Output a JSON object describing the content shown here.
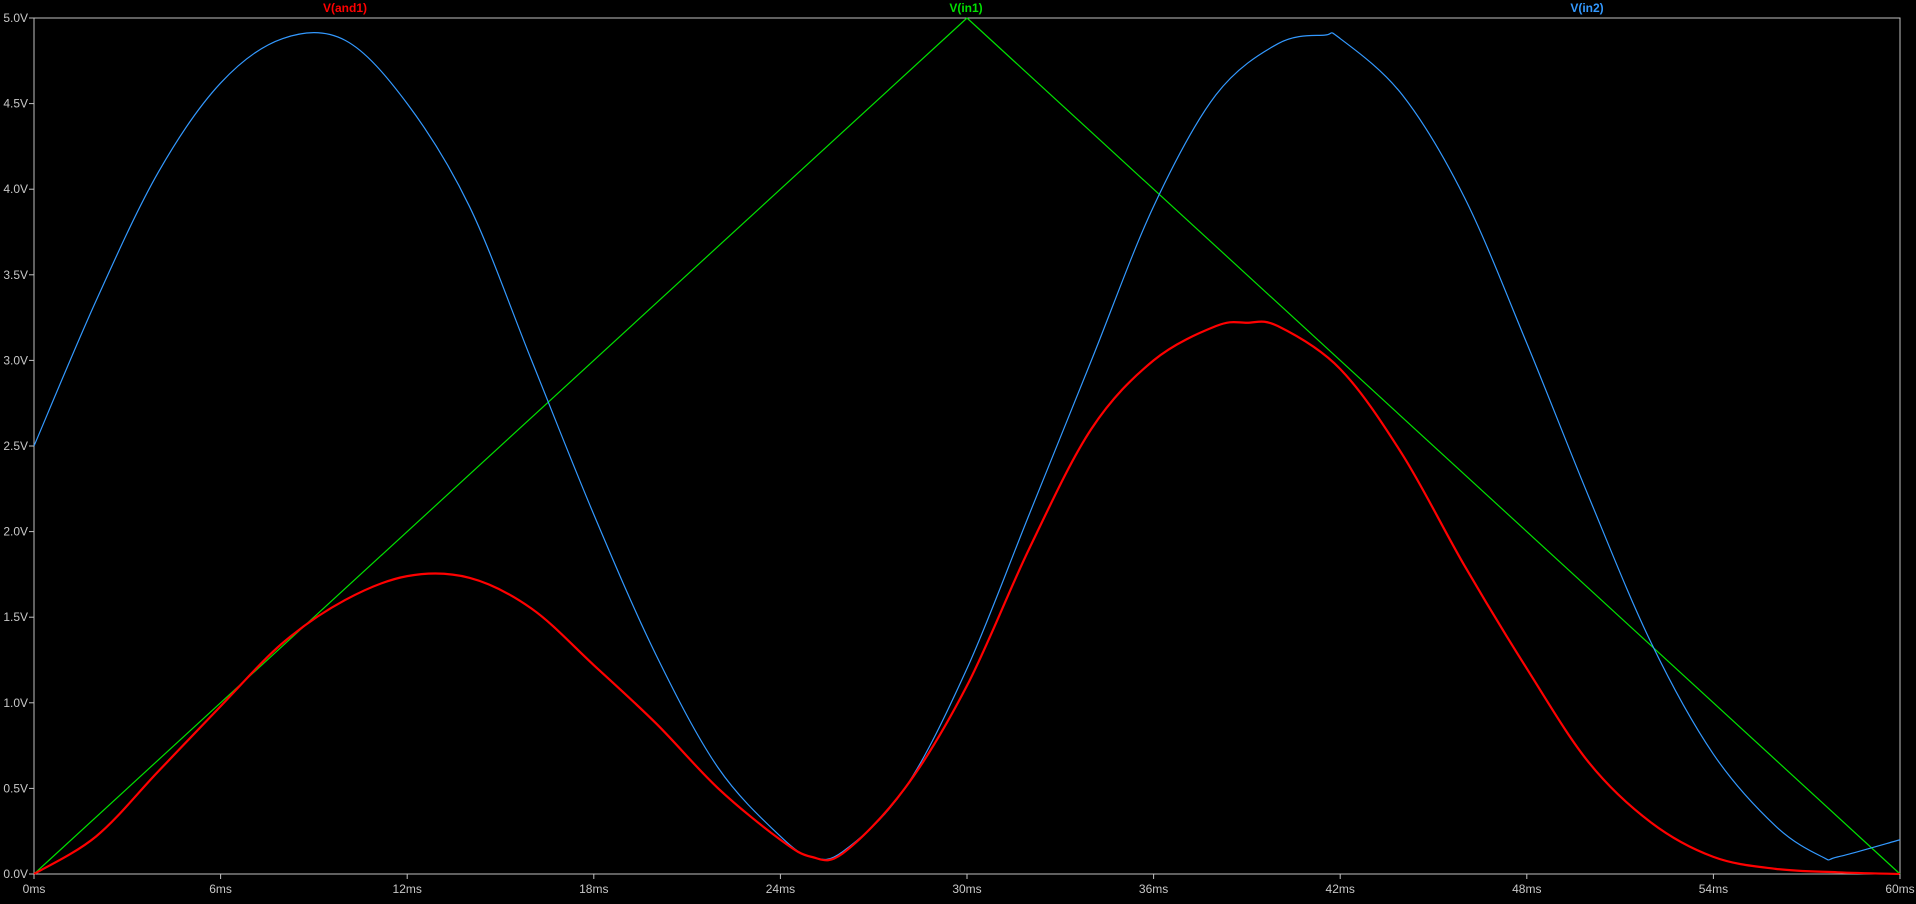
{
  "window": {
    "background": "#000000",
    "frame_color": "#c0c0c0",
    "tick_label_color": "#c8c8c8"
  },
  "chart_data": {
    "type": "line",
    "title": "",
    "xlabel": "",
    "ylabel": "",
    "xlim": [
      0,
      60
    ],
    "ylim": [
      0,
      5
    ],
    "x_unit": "ms",
    "y_unit": "V",
    "grid": false,
    "legend_position": "top",
    "x_ticks": [
      {
        "value": 0,
        "label": "0ms"
      },
      {
        "value": 6,
        "label": "6ms"
      },
      {
        "value": 12,
        "label": "12ms"
      },
      {
        "value": 18,
        "label": "18ms"
      },
      {
        "value": 24,
        "label": "24ms"
      },
      {
        "value": 30,
        "label": "30ms"
      },
      {
        "value": 36,
        "label": "36ms"
      },
      {
        "value": 42,
        "label": "42ms"
      },
      {
        "value": 48,
        "label": "48ms"
      },
      {
        "value": 54,
        "label": "54ms"
      },
      {
        "value": 60,
        "label": "60ms"
      }
    ],
    "y_ticks": [
      {
        "value": 0.0,
        "label": "0.0V"
      },
      {
        "value": 0.5,
        "label": "0.5V"
      },
      {
        "value": 1.0,
        "label": "1.0V"
      },
      {
        "value": 1.5,
        "label": "1.5V"
      },
      {
        "value": 2.0,
        "label": "2.0V"
      },
      {
        "value": 2.5,
        "label": "2.5V"
      },
      {
        "value": 3.0,
        "label": "3.0V"
      },
      {
        "value": 3.5,
        "label": "3.5V"
      },
      {
        "value": 4.0,
        "label": "4.0V"
      },
      {
        "value": 4.5,
        "label": "4.5V"
      },
      {
        "value": 5.0,
        "label": "5.0V"
      }
    ],
    "series": [
      {
        "name": "V(and1)",
        "color": "#ff0000",
        "stroke_weight": "bold",
        "x": [
          0,
          2,
          4,
          6,
          8,
          10,
          12,
          14,
          16,
          18,
          20,
          22,
          24,
          25,
          26,
          28,
          30,
          32,
          34,
          36,
          38,
          39,
          40,
          42,
          44,
          46,
          48,
          50,
          52,
          54,
          56,
          58,
          60
        ],
        "y": [
          0.0,
          0.22,
          0.6,
          0.98,
          1.35,
          1.6,
          1.74,
          1.73,
          1.55,
          1.22,
          0.88,
          0.5,
          0.2,
          0.1,
          0.12,
          0.5,
          1.1,
          1.9,
          2.6,
          3.0,
          3.2,
          3.22,
          3.2,
          2.95,
          2.45,
          1.8,
          1.2,
          0.65,
          0.3,
          0.1,
          0.03,
          0.01,
          0.0
        ]
      },
      {
        "name": "V(in1)",
        "color": "#00e000",
        "stroke_weight": "normal",
        "x": [
          0,
          30,
          60
        ],
        "y": [
          0.0,
          5.0,
          0.0
        ]
      },
      {
        "name": "V(in2)",
        "color": "#3399ff",
        "stroke_weight": "normal",
        "x": [
          0,
          2,
          4,
          6,
          8,
          10,
          12,
          14,
          16,
          18,
          20,
          22,
          24,
          25,
          26,
          28,
          30,
          32,
          34,
          36,
          38,
          40,
          41.5,
          42,
          44,
          46,
          48,
          50,
          52,
          54,
          56,
          57.5,
          58,
          60
        ],
        "y": [
          2.5,
          3.35,
          4.1,
          4.62,
          4.88,
          4.87,
          4.5,
          3.9,
          3.0,
          2.1,
          1.28,
          0.62,
          0.22,
          0.1,
          0.13,
          0.5,
          1.2,
          2.1,
          3.0,
          3.9,
          4.55,
          4.85,
          4.9,
          4.88,
          4.55,
          3.95,
          3.1,
          2.2,
          1.35,
          0.7,
          0.28,
          0.1,
          0.1,
          0.2
        ]
      }
    ]
  }
}
